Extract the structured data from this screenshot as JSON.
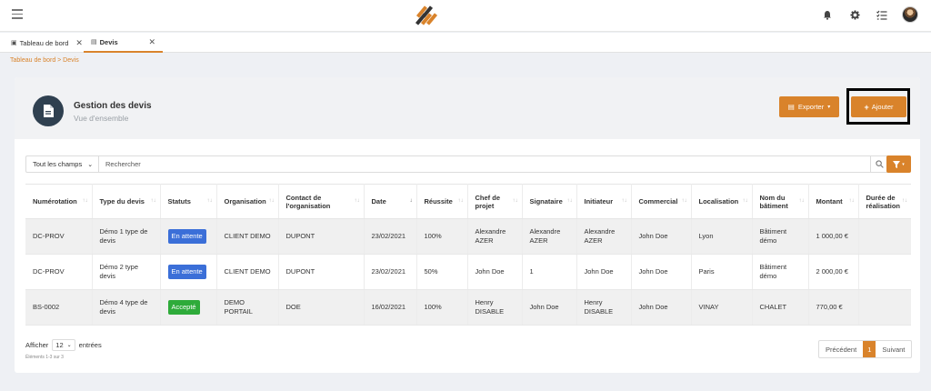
{
  "tabs": [
    {
      "label": "Tableau de bord",
      "close": "✕"
    },
    {
      "label": "Devis",
      "close": "✕"
    }
  ],
  "breadcrumb": "Tableau de bord > Devis",
  "header": {
    "title": "Gestion des devis",
    "subtitle": "Vue d'ensemble",
    "export_label": "Exporter",
    "add_label": "Ajouter"
  },
  "search": {
    "field": "Tout les champs",
    "placeholder": "Rechercher"
  },
  "table": {
    "columns": [
      "Numérotation",
      "Type du devis",
      "Statuts",
      "Organisation",
      "Contact de l'organisation",
      "Date",
      "Réussite",
      "Chef de projet",
      "Signataire",
      "Initiateur",
      "Commercial",
      "Localisation",
      "Nom du bâtiment",
      "Montant",
      "Durée de réalisation"
    ],
    "rows": [
      {
        "num": "DC-PROV",
        "type": "Démo 1 type de devis",
        "status": "En attente",
        "org": "CLIENT DEMO",
        "contact": "DUPONT",
        "date": "23/02/2021",
        "reussite": "100%",
        "chef": "Alexandre AZER",
        "signataire": "Alexandre AZER",
        "initiateur": "Alexandre AZER",
        "commercial": "John Doe",
        "localisation": "Lyon",
        "batiment": "Bâtiment démo",
        "montant": "1 000,00 €",
        "duree": ""
      },
      {
        "num": "DC-PROV",
        "type": "Démo 2 type devis",
        "status": "En attente",
        "org": "CLIENT DEMO",
        "contact": "DUPONT",
        "date": "23/02/2021",
        "reussite": "50%",
        "chef": "John Doe",
        "signataire": "1",
        "initiateur": "John Doe",
        "commercial": "John Doe",
        "localisation": "Paris",
        "batiment": "Bâtiment démo",
        "montant": "2 000,00 €",
        "duree": ""
      },
      {
        "num": "BS-0002",
        "type": "Démo 4 type de devis",
        "status": "Accepté",
        "org": "DEMO PORTAIL",
        "contact": "DOE",
        "date": "16/02/2021",
        "reussite": "100%",
        "chef": "Henry DISABLE",
        "signataire": "John Doe",
        "initiateur": "Henry DISABLE",
        "commercial": "John Doe",
        "localisation": "VINAY",
        "batiment": "CHALET",
        "montant": "770,00 €",
        "duree": ""
      }
    ]
  },
  "footer": {
    "show_prefix": "Afficher",
    "page_size": "12",
    "show_suffix": "entrées",
    "count": "Éléments 1-3 sur 3",
    "prev": "Précédent",
    "current_page": "1",
    "next": "Suivant"
  },
  "colors": {
    "accent": "#d9832b",
    "pending": "#3b6fd8",
    "accepted": "#2eab3a",
    "dark": "#2f4050"
  },
  "icons": [
    "menu-icon",
    "logo",
    "bell-icon",
    "gear-icon",
    "tasks-icon",
    "avatar",
    "document-icon",
    "search-icon",
    "filter-icon"
  ]
}
